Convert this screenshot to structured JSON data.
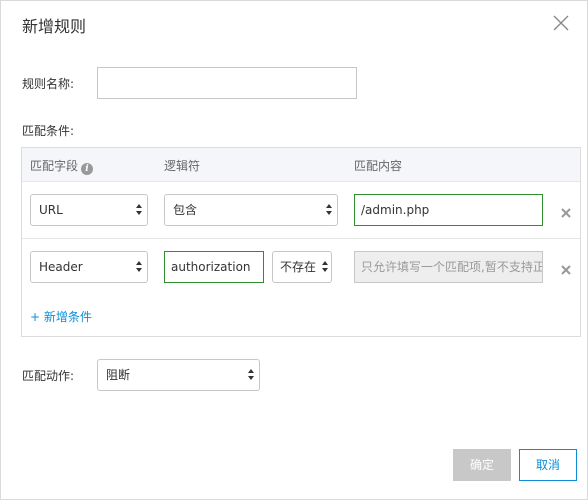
{
  "dialog": {
    "title": "新增规则",
    "close_icon": "close-icon"
  },
  "form": {
    "rule_name_label": "规则名称:",
    "rule_name_value": "",
    "conditions_label": "匹配条件:",
    "action_label": "匹配动作:",
    "action_value": "阻断"
  },
  "conditions": {
    "headers": {
      "field": "匹配字段",
      "operator": "逻辑符",
      "content": "匹配内容"
    },
    "rows": [
      {
        "field": "URL",
        "operator": "包含",
        "content": "/admin.php"
      },
      {
        "field": "Header",
        "header_name": "authorization",
        "operator": "不存在",
        "content_placeholder": "只允许填写一个匹配项,暂不支持正"
      }
    ],
    "add_label": "+ 新增条件"
  },
  "footer": {
    "ok_label": "确定",
    "cancel_label": "取消"
  },
  "colors": {
    "accent": "#0a8fd6",
    "valid_border": "#2f8f2f",
    "disabled_button": "#c8c8c8",
    "header_bg": "#f5f6fa"
  }
}
